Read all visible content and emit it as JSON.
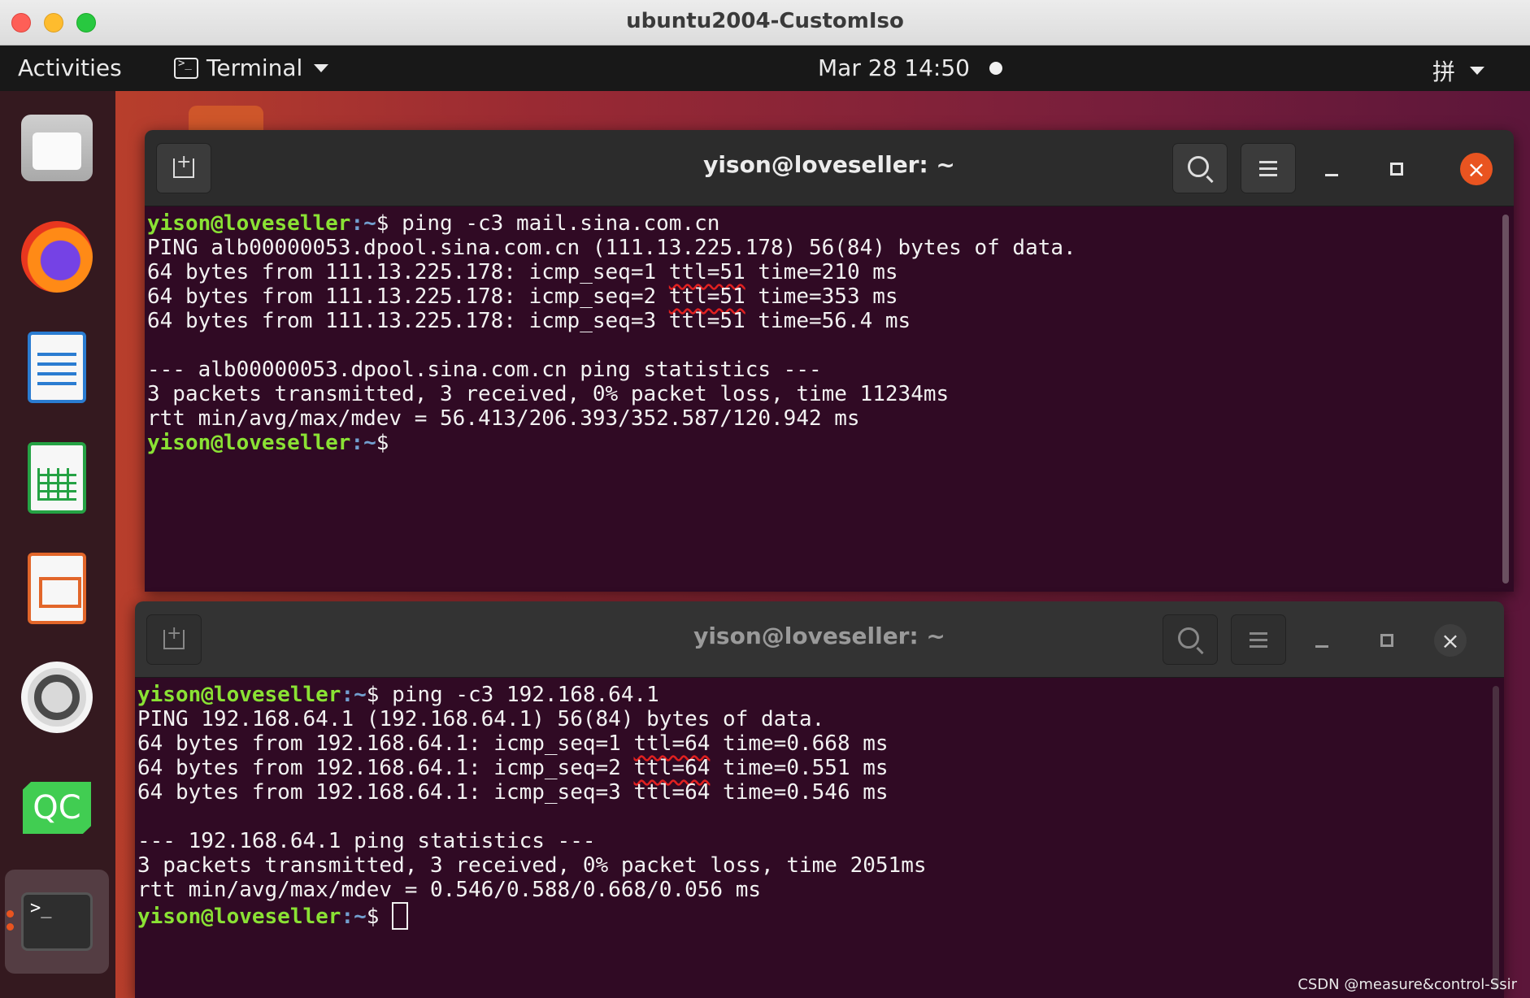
{
  "host_window": {
    "title": "ubuntu2004-CustomIso"
  },
  "topbar": {
    "activities": "Activities",
    "app_menu": "Terminal",
    "clock": "Mar 28  14:50",
    "input_method": "拼"
  },
  "dock": {
    "items": [
      "files",
      "firefox",
      "libreoffice-writer",
      "libreoffice-calc",
      "libreoffice-impress",
      "settings",
      "qt-creator",
      "terminal"
    ]
  },
  "terminal1": {
    "title": "yison@loveseller: ~",
    "lines": [
      {
        "type": "prompt",
        "user": "yison@loveseller",
        "path": ":~",
        "cmd": "$ ping -c3 mail.sina.com.cn"
      },
      {
        "type": "text",
        "text": "PING alb00000053.dpool.sina.com.cn (111.13.225.178) 56(84) bytes of data."
      },
      {
        "type": "reply",
        "pre": "64 bytes from 111.13.225.178: icmp_seq=1 ",
        "ttl": "ttl=51",
        "post": " time=210 ms"
      },
      {
        "type": "reply",
        "pre": "64 bytes from 111.13.225.178: icmp_seq=2 ",
        "ttl": "ttl=51",
        "post": " time=353 ms"
      },
      {
        "type": "reply",
        "pre": "64 bytes from 111.13.225.178: icmp_seq=3 ",
        "ttl": "ttl=51",
        "post": " time=56.4 ms"
      },
      {
        "type": "text",
        "text": ""
      },
      {
        "type": "text",
        "text": "--- alb00000053.dpool.sina.com.cn ping statistics ---"
      },
      {
        "type": "text",
        "text": "3 packets transmitted, 3 received, 0% packet loss, time 11234ms"
      },
      {
        "type": "text",
        "text": "rtt min/avg/max/mdev = 56.413/206.393/352.587/120.942 ms"
      },
      {
        "type": "prompt",
        "user": "yison@loveseller",
        "path": ":~",
        "cmd": "$ "
      }
    ]
  },
  "terminal2": {
    "title": "yison@loveseller: ~",
    "lines": [
      {
        "type": "prompt",
        "user": "yison@loveseller",
        "path": ":~",
        "cmd": "$ ping -c3 192.168.64.1"
      },
      {
        "type": "text",
        "text": "PING 192.168.64.1 (192.168.64.1) 56(84) bytes of data."
      },
      {
        "type": "reply",
        "pre": "64 bytes from 192.168.64.1: icmp_seq=1 ",
        "ttl": "ttl=64",
        "post": " time=0.668 ms"
      },
      {
        "type": "reply",
        "pre": "64 bytes from 192.168.64.1: icmp_seq=2 ",
        "ttl": "ttl=64",
        "post": " time=0.551 ms"
      },
      {
        "type": "reply",
        "pre": "64 bytes from 192.168.64.1: icmp_seq=3 ",
        "ttl": "ttl=64",
        "post": " time=0.546 ms"
      },
      {
        "type": "text",
        "text": ""
      },
      {
        "type": "text",
        "text": "--- 192.168.64.1 ping statistics ---"
      },
      {
        "type": "text",
        "text": "3 packets transmitted, 3 received, 0% packet loss, time 2051ms"
      },
      {
        "type": "text",
        "text": "rtt min/avg/max/mdev = 0.546/0.588/0.668/0.056 ms"
      },
      {
        "type": "prompt",
        "user": "yison@loveseller",
        "path": ":~",
        "cmd": "$ "
      }
    ]
  },
  "watermark": "CSDN @measure&control-Ssir",
  "colors": {
    "terminal_bg": "#300a24",
    "prompt_user": "#8ae234",
    "prompt_path": "#729fcf",
    "accent": "#e95420",
    "annotation_underline": "#e02020"
  }
}
